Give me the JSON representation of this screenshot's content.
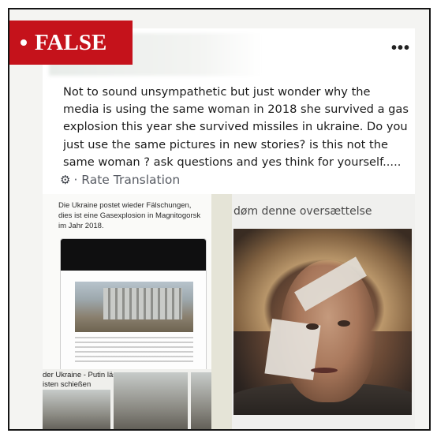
{
  "badge": {
    "label": "FALSE",
    "color": "#c5121b"
  },
  "post": {
    "more_icon": "more-horizontal-icon",
    "more_label": "•••",
    "text_lines": [
      "Not to sound unsympathetic but just wonder why the",
      "media is using the same woman in 2018 she survived a gas",
      "explosion this year she survived missiles in ukraine. Do you",
      "just use the same pictures in new stories? is this not the",
      "same woman ? ask questions and yes think for yourself....."
    ],
    "translate_icon": "gear-icon",
    "translate_label": "· Rate Translation"
  },
  "left_image": {
    "caption_lines": [
      "Die Ukraine postet wieder Fälschungen,",
      "dies ist eine Gasexplosion in Magnitogorsk",
      "im Jahr 2018."
    ],
    "footer_lines": [
      "der Ukraine - Putin lässt",
      "isten schießen"
    ]
  },
  "right_image": {
    "caption": "døm denne oversættelse"
  }
}
